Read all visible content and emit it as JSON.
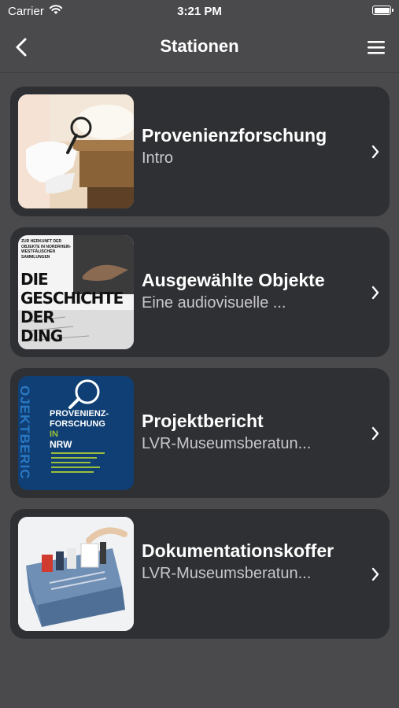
{
  "status": {
    "carrier": "Carrier",
    "time": "3:21 PM"
  },
  "nav": {
    "title": "Stationen"
  },
  "stations": [
    {
      "title": "Provenienzforschung",
      "subtitle": "Intro"
    },
    {
      "title": "Ausgewählte Objekte",
      "subtitle": "Eine audiovisuelle ...",
      "thumb_text": {
        "top": "ZUR HERKUNFT DER OBJEKTE IN NORDRHEIN-WESTFÄLISCHEN SAMMLUNGEN",
        "line1": "DIE",
        "line2": "GESCHICHTE",
        "line3": "DER",
        "line4": "DING"
      }
    },
    {
      "title": "Projektbericht",
      "subtitle": "LVR-Museumsberatun...",
      "thumb_text": {
        "side": "OJEKTBERIC",
        "line1": "PROVENIENZ-",
        "line2": "FORSCHUNG",
        "line3": "IN",
        "line4": "NRW"
      }
    },
    {
      "title": "Dokumentationskoffer",
      "subtitle": "LVR-Museumsberatun..."
    }
  ],
  "colors": {
    "background": "#4a4a4c",
    "card": "#2f3033",
    "subtitle": "#c8c8cc",
    "report_blue": "#0f3f74"
  }
}
